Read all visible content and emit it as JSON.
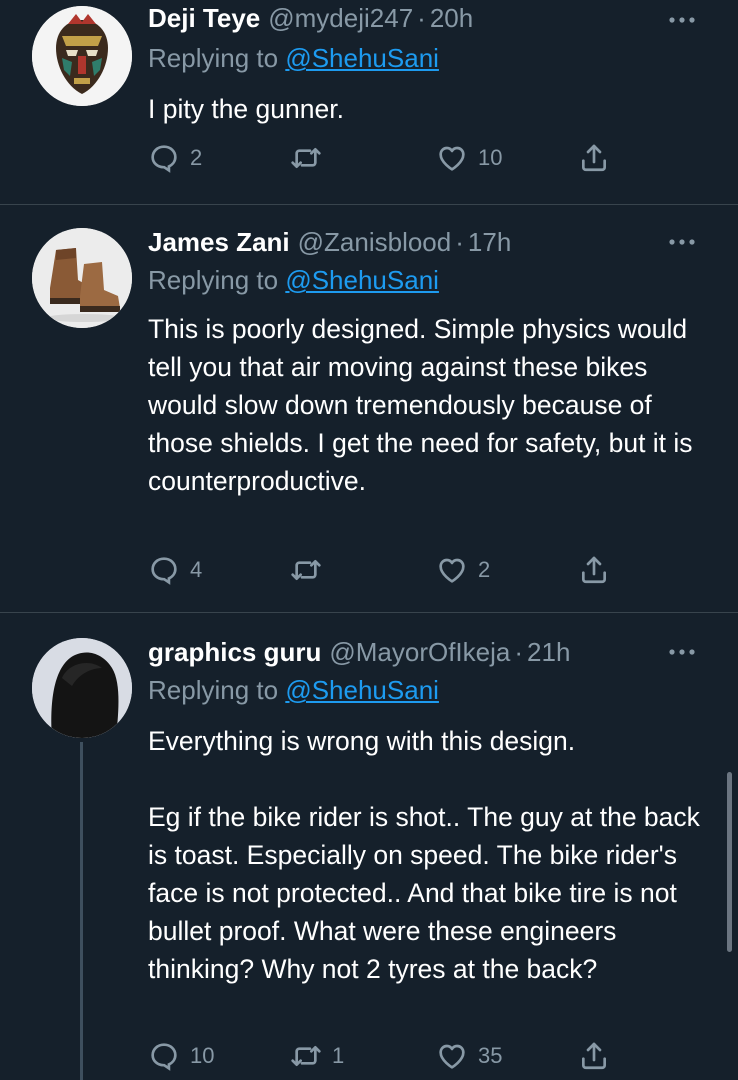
{
  "tweets": [
    {
      "name": "Deji Teye",
      "handle": "@mydeji247",
      "time": "20h",
      "replying_prefix": "Replying to ",
      "replying_to": "@ShehuSani",
      "text": "I pity the gunner.",
      "replies": "2",
      "retweets": "",
      "likes": "10",
      "avatar_icon": "tribal-mask-avatar"
    },
    {
      "name": "James Zani",
      "handle": "@Zanisblood",
      "time": "17h",
      "replying_prefix": "Replying to ",
      "replying_to": "@ShehuSani",
      "text": "This is poorly designed. Simple physics would tell you that air moving against these bikes would slow down tremendously because of those shields. I get the need for safety, but it is counterproductive.",
      "replies": "4",
      "retweets": "",
      "likes": "2",
      "avatar_icon": "boots-avatar"
    },
    {
      "name": "graphics guru",
      "handle": "@MayorOfIkeja",
      "time": "21h",
      "replying_prefix": "Replying to ",
      "replying_to": "@ShehuSani",
      "text": "Everything is wrong with this design.\n\nEg if the bike rider is shot.. The guy at the back is toast. Especially on speed. The bike rider's face is not protected.. And that bike tire is not bullet proof. What were these engineers thinking? Why not 2 tyres at the back?",
      "replies": "10",
      "retweets": "1",
      "likes": "35",
      "avatar_icon": "dark-hair-avatar"
    }
  ],
  "colors": {
    "background": "#15202b",
    "secondary_text": "#8899a6",
    "link": "#1d9bf0",
    "divider": "#38444d"
  }
}
